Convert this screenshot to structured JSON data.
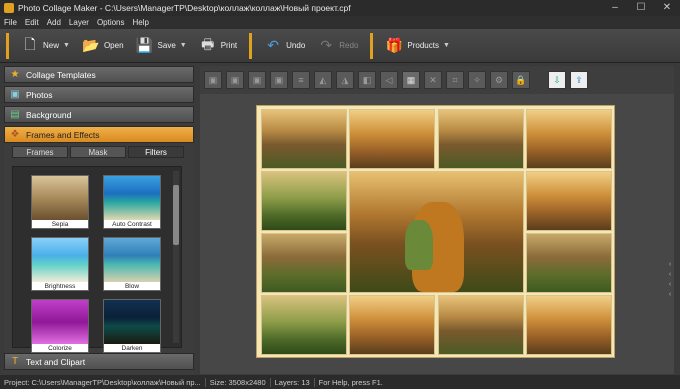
{
  "window": {
    "title": "Photo Collage Maker - C:\\Users\\ManagerTP\\Desktop\\коллаж\\коллаж\\Новый проект.cpf"
  },
  "menu": [
    "File",
    "Edit",
    "Add",
    "Layer",
    "Options",
    "Help"
  ],
  "toolbar": {
    "new": "New",
    "open": "Open",
    "save": "Save",
    "print": "Print",
    "undo": "Undo",
    "redo": "Redo",
    "products": "Products"
  },
  "panel": {
    "sections": [
      "Collage Templates",
      "Photos",
      "Background",
      "Frames and Effects"
    ],
    "active_section": "Frames and Effects",
    "tabs": [
      "Frames",
      "Mask",
      "Filters"
    ],
    "active_tab": "Filters",
    "filters": [
      "Sepia",
      "Auto Contrast",
      "Brightness",
      "Blow",
      "Colorize",
      "Darken"
    ],
    "bottom_section": "Text and Clipart"
  },
  "status": {
    "project": "Project: C:\\Users\\ManagerTP\\Desktop\\коллаж\\Новый пр...",
    "size": "Size: 3508x2480",
    "layers": "Layers: 13",
    "help": "For Help, press F1."
  },
  "colors": {
    "accent": "#e0a020",
    "canvas_bg": "#f5e6b8"
  }
}
